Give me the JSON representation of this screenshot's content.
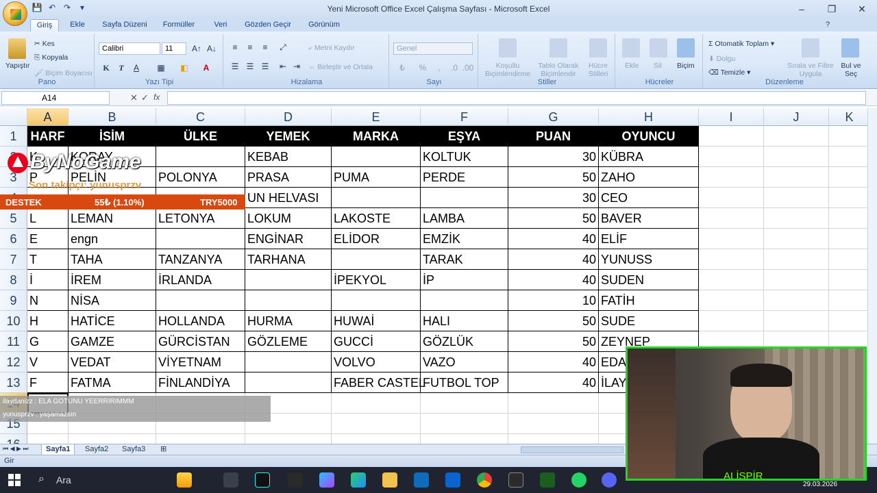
{
  "window": {
    "title": "Yeni Microsoft Office Excel Çalışma Sayfası - Microsoft Excel"
  },
  "tabs": [
    "Giriş",
    "Ekle",
    "Sayfa Düzeni",
    "Formüller",
    "Veri",
    "Gözden Geçir",
    "Görünüm"
  ],
  "ribbon": {
    "pano": {
      "label": "Pano",
      "paste": "Yapıştır",
      "cut": "Kes",
      "copy": "Kopyala",
      "format_painter": "Biçim Boyacısı"
    },
    "font": {
      "label": "Yazı Tipi",
      "name": "Calibri",
      "size": "11",
      "bold": "K",
      "italic": "T",
      "underline": "A"
    },
    "alignment": {
      "label": "Hizalama",
      "wrap": "Metni Kaydır",
      "merge": "Birleştir ve Ortala"
    },
    "number": {
      "label": "Sayı",
      "format": "Genel",
      "percent": "%"
    },
    "styles": {
      "label": "Stiller",
      "conditional": "Koşullu Biçimlendirme",
      "table": "Tablo Olarak Biçimlendir",
      "cell": "Hücre Stilleri"
    },
    "cells": {
      "label": "Hücreler",
      "insert": "Ekle",
      "delete": "Sil",
      "format": "Biçim"
    },
    "editing": {
      "label": "Düzenleme",
      "autosum": "Otomatik Toplam",
      "fill": "Dolgu",
      "clear": "Temizle",
      "sort": "Sırala ve Filtre Uygula",
      "find": "Bul ve Seç"
    }
  },
  "formula_bar": {
    "namebox": "A14",
    "fx": "fx"
  },
  "columns": [
    "A",
    "B",
    "C",
    "D",
    "E",
    "F",
    "G",
    "H",
    "I",
    "J",
    "K"
  ],
  "rows": [
    "1",
    "2",
    "3",
    "4",
    "5",
    "6",
    "7",
    "8",
    "9",
    "10",
    "11",
    "12",
    "13",
    "14",
    "15",
    "16"
  ],
  "table": {
    "headers": [
      "HARF",
      "İSİM",
      "ÜLKE",
      "YEMEK",
      "MARKA",
      "EŞYA",
      "PUAN",
      "OYUNCU"
    ],
    "rows": [
      [
        "K",
        "KORAY",
        "",
        "KEBAB",
        "",
        "KOLTUK",
        "30",
        "KÜBRA"
      ],
      [
        "P",
        "PELİN",
        "POLONYA",
        "PRASA",
        "PUMA",
        "PERDE",
        "50",
        "ZAHO"
      ],
      [
        "",
        "",
        "",
        "UN HELVASI",
        "",
        "",
        "30",
        "CEO"
      ],
      [
        "L",
        "LEMAN",
        "LETONYA",
        "LOKUM",
        "LAKOSTE",
        "LAMBA",
        "50",
        "BAVER"
      ],
      [
        "E",
        "engn",
        "",
        "ENGİNAR",
        "ELİDOR",
        "EMZİK",
        "40",
        "ELİF"
      ],
      [
        "T",
        "TAHA",
        "TANZANYA",
        "TARHANA",
        "",
        "TARAK",
        "40",
        "YUNUSS"
      ],
      [
        "İ",
        "İREM",
        "İRLANDA",
        "",
        "İPEKYOL",
        "İP",
        "40",
        "SUDEN"
      ],
      [
        "N",
        "NİSA",
        "",
        "",
        "",
        "",
        "10",
        "FATİH"
      ],
      [
        "H",
        "HATİCE",
        "HOLLANDA",
        "HURMA",
        "HUWAİ",
        "HALI",
        "50",
        "SUDE"
      ],
      [
        "G",
        "GAMZE",
        "GÜRCİSTAN",
        "GÖZLEME",
        "GUCCİ",
        "GÖZLÜK",
        "50",
        "ZEYNEP"
      ],
      [
        "V",
        "VEDAT",
        "VİYETNAM",
        "",
        "VOLVO",
        "VAZO",
        "40",
        "EDA"
      ],
      [
        "F",
        "FATMA",
        "FİNLANDİYA",
        "",
        "FABER CASTEL",
        "FUTBOL TOP",
        "40",
        "İLAY"
      ]
    ]
  },
  "overlay": {
    "brand": "ByNoGame",
    "last_follower": "Son takipçi: yunusprzv",
    "destek_label": "DESTEK",
    "destek_amount": "55₺ (1.10%)",
    "destek_goal": "TRY5000",
    "chat": [
      {
        "user": "ilaydanizz",
        "msg": "ELA GOTUNU YEERRIRIMMM"
      },
      {
        "user": "yunusprzv",
        "msg": "yaşamazsın"
      }
    ],
    "webcam_name": "ALİSPİR"
  },
  "sheets": [
    "Sayfa1",
    "Sayfa2",
    "Sayfa3"
  ],
  "status": "Gir",
  "taskbar": {
    "search": "Ara",
    "date": "29.03.2026"
  },
  "colors": {
    "accent_green": "#1fd81f",
    "destek_orange": "#d9480f",
    "header_black": "#000000"
  }
}
